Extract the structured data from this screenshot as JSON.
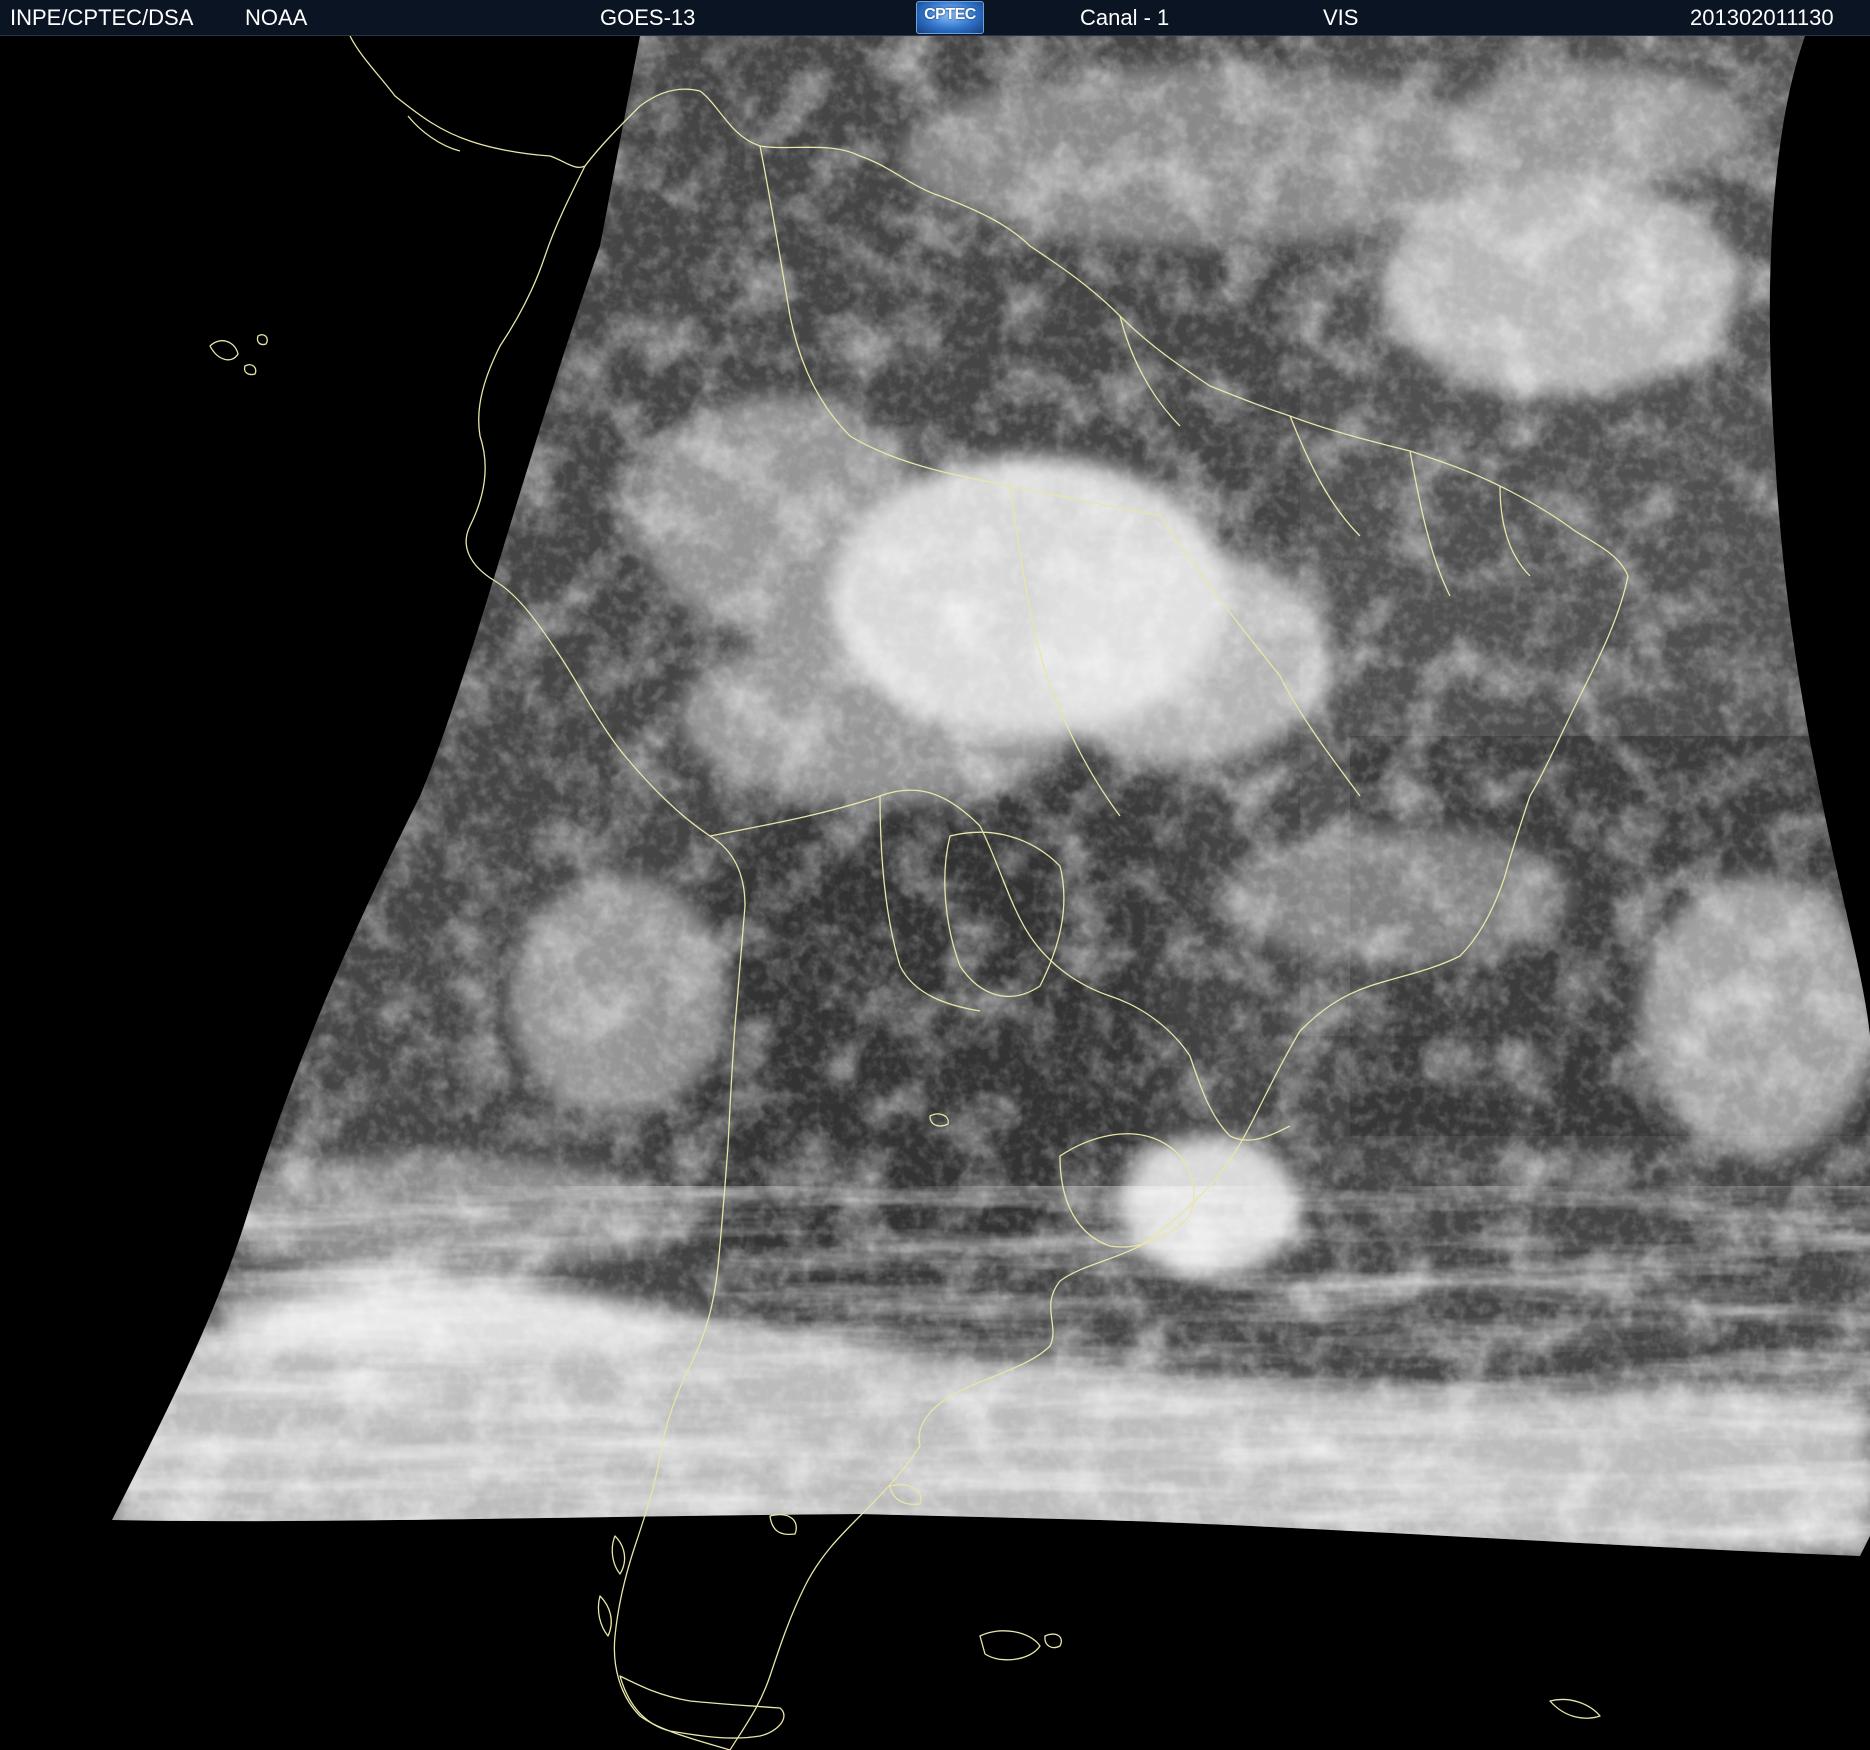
{
  "header": {
    "agency": "INPE/CPTEC/DSA",
    "source": "NOAA",
    "satellite": "GOES-13",
    "logo_text": "CPTEC",
    "channel": "Canal - 1",
    "band": "VIS",
    "timestamp": "201302011130"
  },
  "image": {
    "description_type": "satellite-visible-imagery",
    "coastline_color": "#e8e6a8",
    "background_color": "#000000"
  }
}
